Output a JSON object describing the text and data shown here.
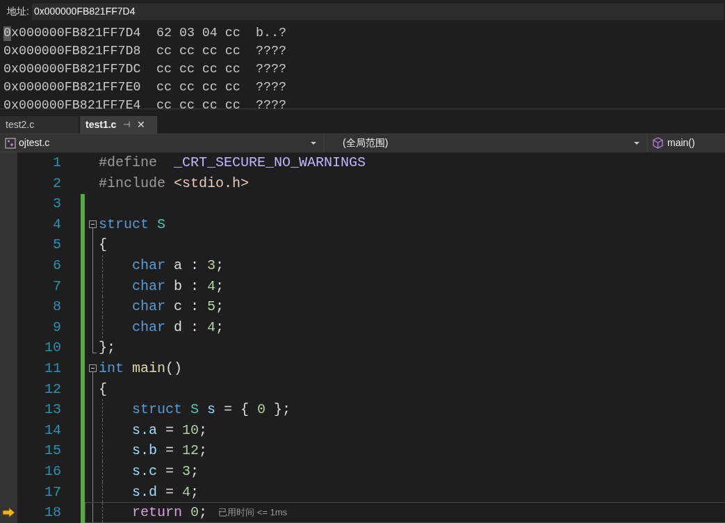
{
  "memory": {
    "address_label": "地址:",
    "address_value": "0x000000FB821FF7D4",
    "rows": [
      {
        "address": "0x000000FB821FF7D4",
        "bytes": "62 03 04 cc",
        "ascii": "b..?",
        "cursor": true
      },
      {
        "address": "0x000000FB821FF7D8",
        "bytes": "cc cc cc cc",
        "ascii": "????",
        "cursor": false
      },
      {
        "address": "0x000000FB821FF7DC",
        "bytes": "cc cc cc cc",
        "ascii": "????",
        "cursor": false
      },
      {
        "address": "0x000000FB821FF7E0",
        "bytes": "cc cc cc cc",
        "ascii": "????",
        "cursor": false
      },
      {
        "address": "0x000000FB821FF7E4",
        "bytes": "cc cc cc cc",
        "ascii": "????",
        "cursor": false
      }
    ]
  },
  "tabs": [
    {
      "label": "test2.c",
      "selected": false
    },
    {
      "label": "test1.c",
      "selected": true,
      "pin": "⊣",
      "close": "✕"
    }
  ],
  "navigation": {
    "project": "ojtest.c",
    "scope": "(全局范围)",
    "member": "main()"
  },
  "lines": [
    {
      "number": "1",
      "kind": "plain",
      "changed": false,
      "current": false,
      "tokens": [
        {
          "kind": "pre",
          "text": "#define  "
        },
        {
          "kind": "macro",
          "text": "_CRT_SECURE_NO_WARNINGS"
        }
      ]
    },
    {
      "number": "2",
      "kind": "plain",
      "changed": false,
      "current": false,
      "tokens": [
        {
          "kind": "pre",
          "text": "#include "
        },
        {
          "kind": "string",
          "text": "<stdio.h>"
        }
      ]
    },
    {
      "number": "3",
      "kind": "plain",
      "changed": true,
      "current": false
    },
    {
      "number": "4",
      "kind": "header",
      "changed": true,
      "current": false,
      "tokens": [
        {
          "kind": "keyword",
          "text": "struct "
        },
        {
          "kind": "type",
          "text": "S"
        }
      ]
    },
    {
      "number": "5",
      "kind": "body",
      "changed": true,
      "current": false,
      "tokens": [
        {
          "kind": "plain",
          "text": "{"
        }
      ]
    },
    {
      "number": "6",
      "kind": "body",
      "changed": true,
      "current": false,
      "tokens": [
        {
          "kind": "keyword",
          "text": "    char"
        },
        {
          "kind": "plain",
          "text": " a : "
        },
        {
          "kind": "number",
          "text": "3"
        },
        {
          "kind": "plain",
          "text": ";"
        }
      ]
    },
    {
      "number": "7",
      "kind": "body",
      "changed": true,
      "current": false,
      "tokens": [
        {
          "kind": "keyword",
          "text": "    char"
        },
        {
          "kind": "plain",
          "text": " b : "
        },
        {
          "kind": "number",
          "text": "4"
        },
        {
          "kind": "plain",
          "text": ";"
        }
      ]
    },
    {
      "number": "8",
      "kind": "body",
      "changed": true,
      "current": false,
      "tokens": [
        {
          "kind": "keyword",
          "text": "    char"
        },
        {
          "kind": "plain",
          "text": " c : "
        },
        {
          "kind": "number",
          "text": "5"
        },
        {
          "kind": "plain",
          "text": ";"
        }
      ]
    },
    {
      "number": "9",
      "kind": "body",
      "changed": true,
      "current": false,
      "tokens": [
        {
          "kind": "keyword",
          "text": "    char"
        },
        {
          "kind": "plain",
          "text": " d : "
        },
        {
          "kind": "number",
          "text": "4"
        },
        {
          "kind": "plain",
          "text": ";"
        }
      ]
    },
    {
      "number": "10",
      "kind": "closing",
      "changed": true,
      "current": false,
      "tokens": [
        {
          "kind": "plain",
          "text": "};"
        }
      ]
    },
    {
      "number": "11",
      "kind": "header",
      "changed": true,
      "current": false,
      "tokens": [
        {
          "kind": "keyword",
          "text": "int "
        },
        {
          "kind": "function",
          "text": "main"
        },
        {
          "kind": "plain",
          "text": "()"
        }
      ]
    },
    {
      "number": "12",
      "kind": "body",
      "changed": true,
      "current": false,
      "tokens": [
        {
          "kind": "plain",
          "text": "{"
        }
      ]
    },
    {
      "number": "13",
      "kind": "body",
      "changed": true,
      "current": false,
      "tokens": [
        {
          "kind": "keyword",
          "text": "    struct "
        },
        {
          "kind": "type",
          "text": "S "
        },
        {
          "kind": "variable",
          "text": "s"
        },
        {
          "kind": "plain",
          "text": " = { "
        },
        {
          "kind": "number",
          "text": "0"
        },
        {
          "kind": "plain",
          "text": " };"
        }
      ]
    },
    {
      "number": "14",
      "kind": "body",
      "changed": true,
      "current": false,
      "tokens": [
        {
          "kind": "variable",
          "text": "    s.a"
        },
        {
          "kind": "plain",
          "text": " = "
        },
        {
          "kind": "number",
          "text": "10"
        },
        {
          "kind": "plain",
          "text": ";"
        }
      ]
    },
    {
      "number": "15",
      "kind": "body",
      "changed": true,
      "current": false,
      "tokens": [
        {
          "kind": "variable",
          "text": "    s.b"
        },
        {
          "kind": "plain",
          "text": " = "
        },
        {
          "kind": "number",
          "text": "12"
        },
        {
          "kind": "plain",
          "text": ";"
        }
      ]
    },
    {
      "number": "16",
      "kind": "body",
      "changed": true,
      "current": false,
      "tokens": [
        {
          "kind": "variable",
          "text": "    s.c"
        },
        {
          "kind": "plain",
          "text": " = "
        },
        {
          "kind": "number",
          "text": "3"
        },
        {
          "kind": "plain",
          "text": ";"
        }
      ]
    },
    {
      "number": "17",
      "kind": "body",
      "changed": true,
      "current": false,
      "tokens": [
        {
          "kind": "variable",
          "text": "    s.d"
        },
        {
          "kind": "plain",
          "text": " = "
        },
        {
          "kind": "number",
          "text": "4"
        },
        {
          "kind": "plain",
          "text": ";"
        }
      ]
    },
    {
      "number": "18",
      "kind": "body",
      "changed": true,
      "current": true,
      "hint": "已用时间 <= 1ms",
      "tokens": [
        {
          "kind": "control",
          "text": "    return "
        },
        {
          "kind": "number",
          "text": "0"
        },
        {
          "kind": "plain",
          "text": ";"
        }
      ]
    }
  ]
}
